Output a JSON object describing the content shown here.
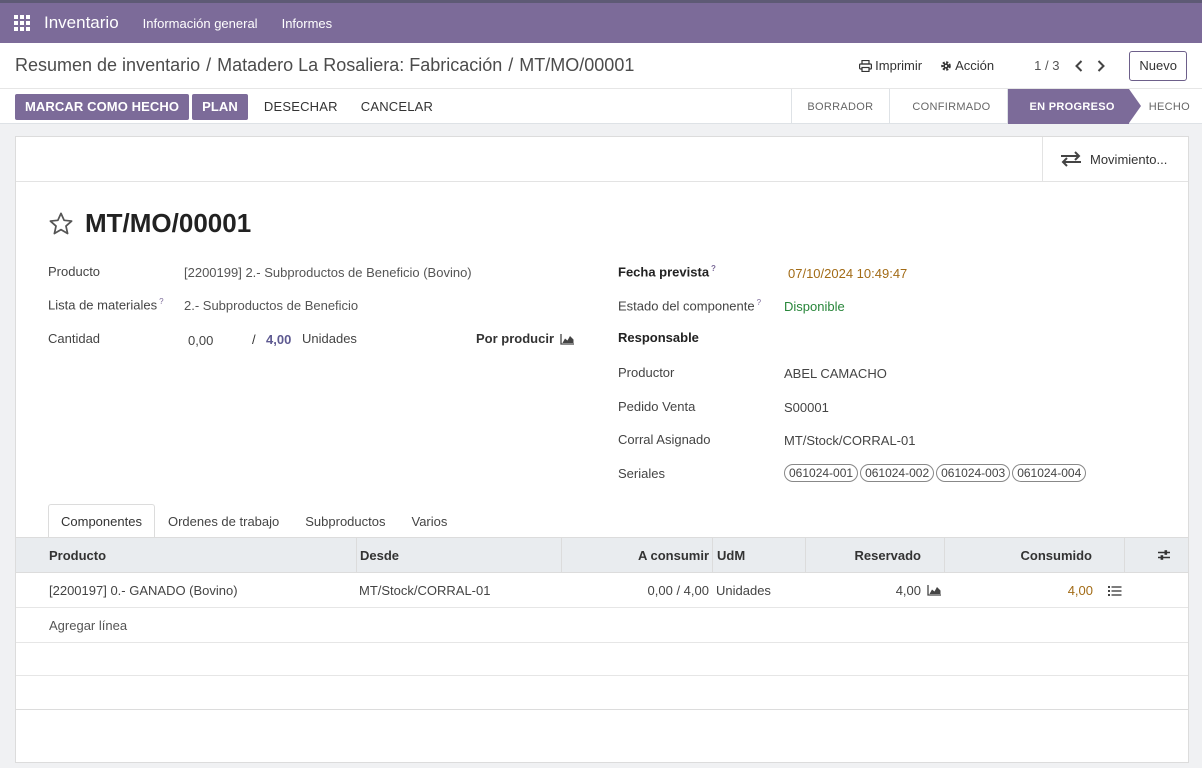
{
  "nav": {
    "app_name": "Inventario",
    "menu": [
      "Información general",
      "Informes"
    ]
  },
  "breadcrumb": {
    "items": [
      "Resumen de inventario",
      "Matadero La Rosaliera: Fabricación"
    ],
    "current": "MT/MO/00001",
    "separator": "/"
  },
  "cp": {
    "print_label": "Imprimir",
    "action_label": "Acción",
    "pager": "1 / 3",
    "new_label": "Nuevo"
  },
  "actions": {
    "mark_done": "MARCAR COMO HECHO",
    "plan": "PLAN",
    "discard": "DESECHAR",
    "cancel": "CANCELAR"
  },
  "status": {
    "stages": [
      "BORRADOR",
      "CONFIRMADO",
      "EN PROGRESO",
      "HECHO"
    ],
    "active": "EN PROGRESO"
  },
  "smart_button": {
    "label": "Movimiento..."
  },
  "record": {
    "title": "MT/MO/00001",
    "left": {
      "product_label": "Producto",
      "product_value": "[2200199] 2.- Subproductos de Beneficio (Bovino)",
      "bom_label": "Lista de materiales",
      "bom_help": "?",
      "bom_value": "2.- Subproductos de Beneficio",
      "qty_label": "Cantidad",
      "qty_value": "0,00",
      "qty_sep": "/",
      "qty_total": "4,00",
      "qty_uom": "Unidades",
      "to_produce_label": "Por producir"
    },
    "right": {
      "date_label": "Fecha prevista",
      "date_help": "?",
      "date_value": "07/10/2024 10:49:47",
      "comp_status_label": "Estado del componente",
      "comp_status_help": "?",
      "comp_status_value": "Disponible",
      "responsible_label": "Responsable",
      "producer_label": "Productor",
      "producer_value": "ABEL CAMACHO",
      "sale_order_label": "Pedido Venta",
      "sale_order_value": "S00001",
      "corral_label": "Corral Asignado",
      "corral_value": "MT/Stock/CORRAL-01",
      "serials_label": "Seriales",
      "serials": [
        "061024-001",
        "061024-002",
        "061024-003",
        "061024-004"
      ]
    }
  },
  "tabs": [
    "Componentes",
    "Ordenes de trabajo",
    "Subproductos",
    "Varios"
  ],
  "components": {
    "headers": {
      "product": "Producto",
      "from": "Desde",
      "to_consume": "A consumir",
      "uom": "UdM",
      "reserved": "Reservado",
      "consumed": "Consumido"
    },
    "rows": [
      {
        "product": "[2200197] 0.- GANADO (Bovino)",
        "from": "MT/Stock/CORRAL-01",
        "to_consume": "0,00 /  4,00",
        "uom": "Unidades",
        "reserved": "4,00",
        "consumed": "4,00"
      }
    ],
    "add_line": "Agregar línea"
  },
  "colors": {
    "brand": "#7c6b99",
    "warning": "#a26b16",
    "success": "#28863a"
  }
}
